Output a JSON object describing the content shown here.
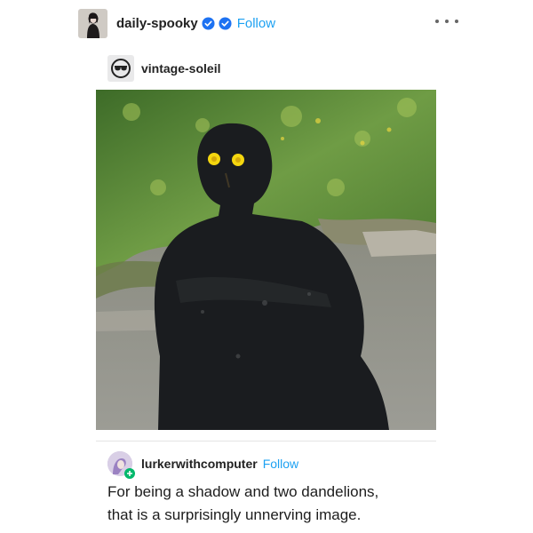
{
  "post": {
    "author": "daily-spooky",
    "follow_label": "Follow",
    "badge_icons": [
      "verified-check-icon",
      "verified-check-icon"
    ],
    "more_icon": "more-dots-icon"
  },
  "reblog": {
    "author": "vintage-soleil"
  },
  "photo": {
    "subject_icon": "shadow-photo"
  },
  "reply": {
    "author": "lurkerwithcomputer",
    "follow_label": "Follow",
    "text_line1": "For being a shadow and two dandelions,",
    "text_line2": "that is a surprisingly unnerving image."
  },
  "colors": {
    "follow": "#1da1f2",
    "badge": "#1d72f2",
    "grass": "#5d8a3a",
    "dandelion": "#f4d60f",
    "shadow": "#1a1c1f",
    "ground": "#8b8d83"
  }
}
